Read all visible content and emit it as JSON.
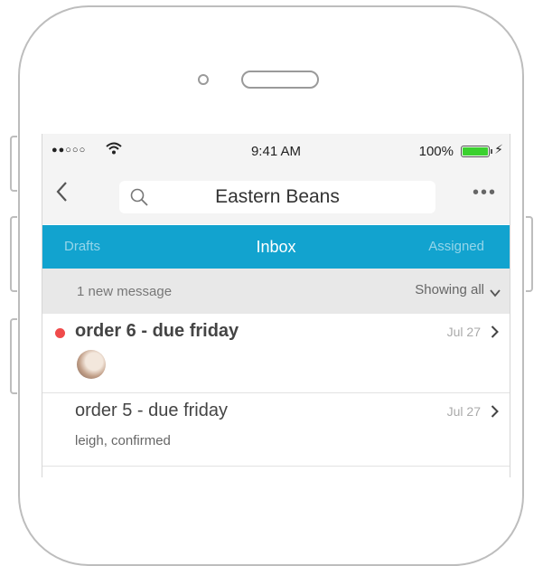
{
  "status_bar": {
    "signal": "●●○○○",
    "time": "9:41 AM",
    "battery": "100%",
    "battery_level_percent": 100,
    "battery_color": "#3bd12f"
  },
  "nav": {
    "title": "Eastern Beans",
    "more": "•••"
  },
  "tabs": [
    {
      "label": "Drafts",
      "active": false
    },
    {
      "label": "Inbox",
      "active": true
    },
    {
      "label": "Assigned",
      "active": false
    }
  ],
  "info": {
    "new_count": "1 new message",
    "filter": "Showing all"
  },
  "messages": [
    {
      "title": "order 6 - due friday",
      "date": "Jul 27",
      "unread": true,
      "subtitle": ""
    },
    {
      "title": "order 5 - due friday",
      "date": "Jul 27",
      "unread": false,
      "subtitle": "leigh, confirmed"
    }
  ],
  "colors": {
    "tab_bar": "#12a3cf",
    "unread_dot": "#f04b4b"
  }
}
